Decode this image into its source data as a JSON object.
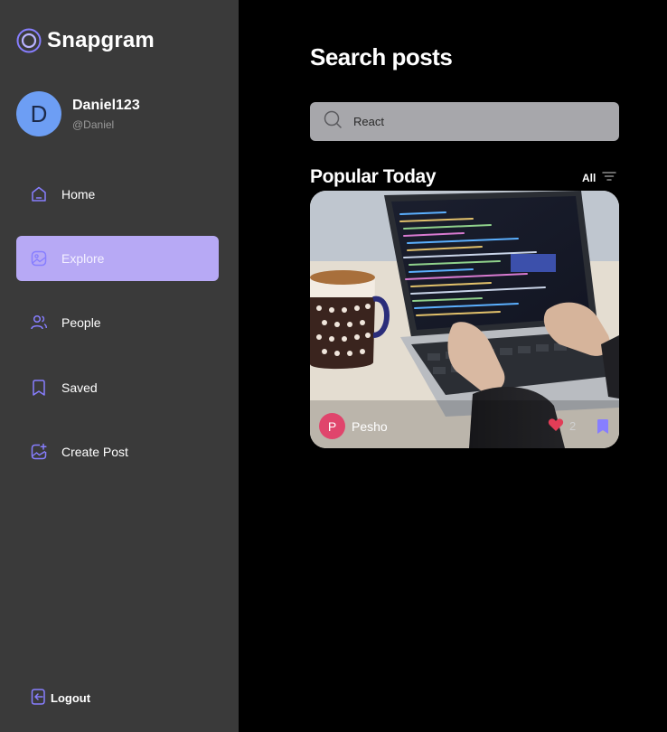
{
  "app": {
    "name": "Snapgram"
  },
  "profile": {
    "initial": "D",
    "name": "Daniel123",
    "handle": "@Daniel"
  },
  "nav": {
    "items": [
      {
        "label": "Home",
        "icon": "home-icon"
      },
      {
        "label": "Explore",
        "icon": "image-icon",
        "active": true
      },
      {
        "label": "People",
        "icon": "people-icon"
      },
      {
        "label": "Saved",
        "icon": "bookmark-icon"
      },
      {
        "label": "Create Post",
        "icon": "gallery-add-icon"
      }
    ],
    "logout_label": "Logout"
  },
  "main": {
    "title": "Search posts",
    "search": {
      "value": "React",
      "placeholder": "Search"
    },
    "section_title": "Popular Today",
    "filter_label": "All"
  },
  "posts": [
    {
      "author_initial": "P",
      "author": "Pesho",
      "likes": "2",
      "image": "laptop-coding-photo"
    }
  ],
  "colors": {
    "accent": "#877eff",
    "active_nav": "#b7a9f5",
    "sidebar_bg": "#3a3a3a",
    "like": "#e23d57"
  }
}
